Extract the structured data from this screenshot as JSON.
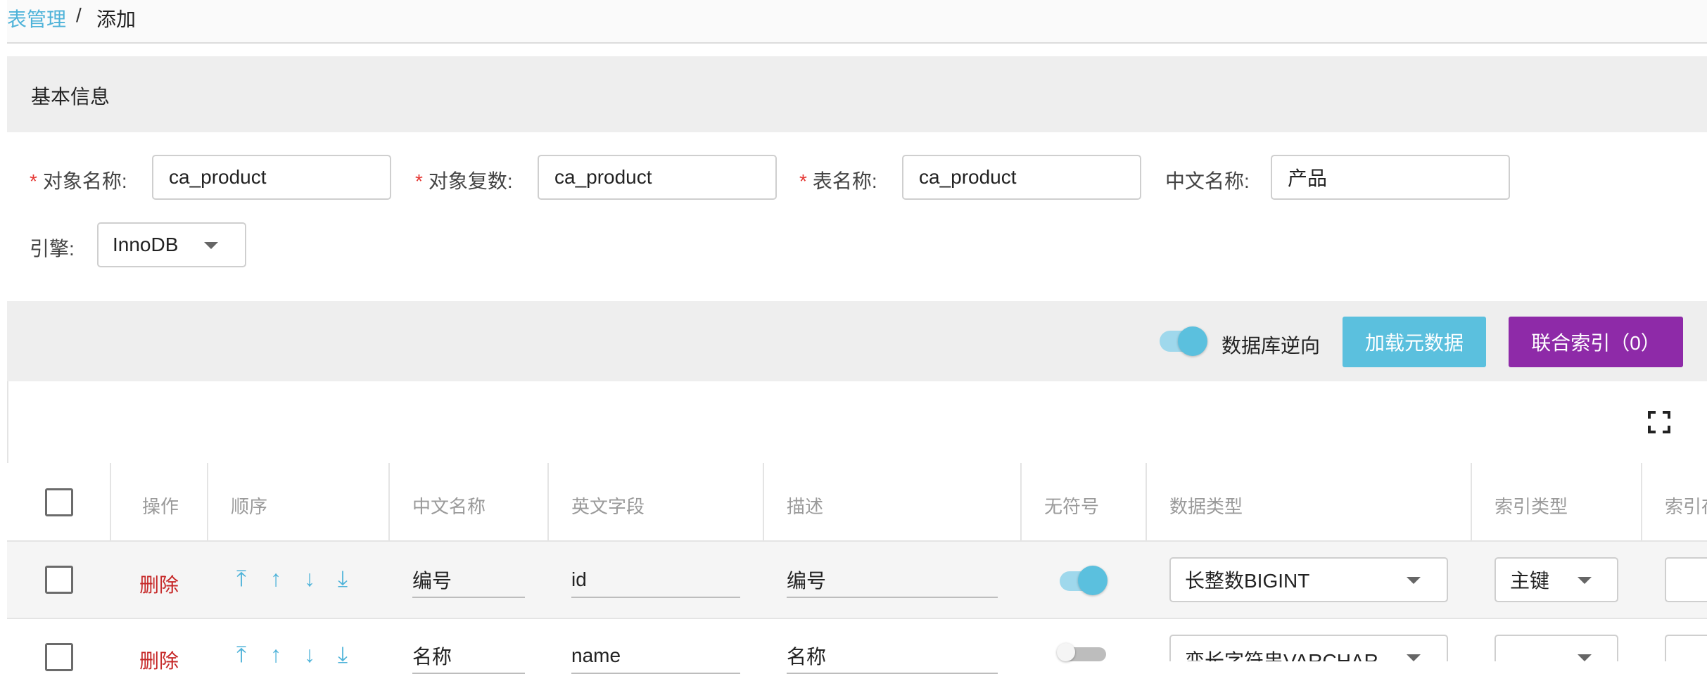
{
  "breadcrumb": {
    "parent": "表管理",
    "separator": "/",
    "current": "添加"
  },
  "basic_info": {
    "title": "基本信息",
    "object_name": {
      "label": "对象名称:",
      "value": "ca_product"
    },
    "object_plural": {
      "label": "对象复数:",
      "value": "ca_product"
    },
    "table_name": {
      "label": "表名称:",
      "value": "ca_product"
    },
    "chinese_name": {
      "label": "中文名称:",
      "value": "产品"
    },
    "engine": {
      "label": "引擎:",
      "value": "InnoDB"
    }
  },
  "toolbar": {
    "reverse_label": "数据库逆向",
    "reverse_on": true,
    "load_metadata": "加载元数据",
    "union_index": "联合索引（0）",
    "colors": {
      "primary": "#5bc0de",
      "purple": "#8e2aa8"
    }
  },
  "table": {
    "columns": [
      "操作",
      "顺序",
      "中文名称",
      "英文字段",
      "描述",
      "无符号",
      "数据类型",
      "索引类型",
      "索引存"
    ],
    "rows": [
      {
        "action": "删除",
        "chinese_name": "编号",
        "english_field": "id",
        "description": "编号",
        "unsigned": true,
        "data_type": "长整数BIGINT",
        "index_type": "主键"
      },
      {
        "action": "删除",
        "chinese_name": "名称",
        "english_field": "name",
        "description": "名称",
        "unsigned": false,
        "data_type": "变长字符串VARCHAR",
        "index_type": ""
      }
    ],
    "order_icons": [
      "move-top-icon",
      "move-up-icon",
      "move-down-icon",
      "move-bottom-icon"
    ]
  }
}
